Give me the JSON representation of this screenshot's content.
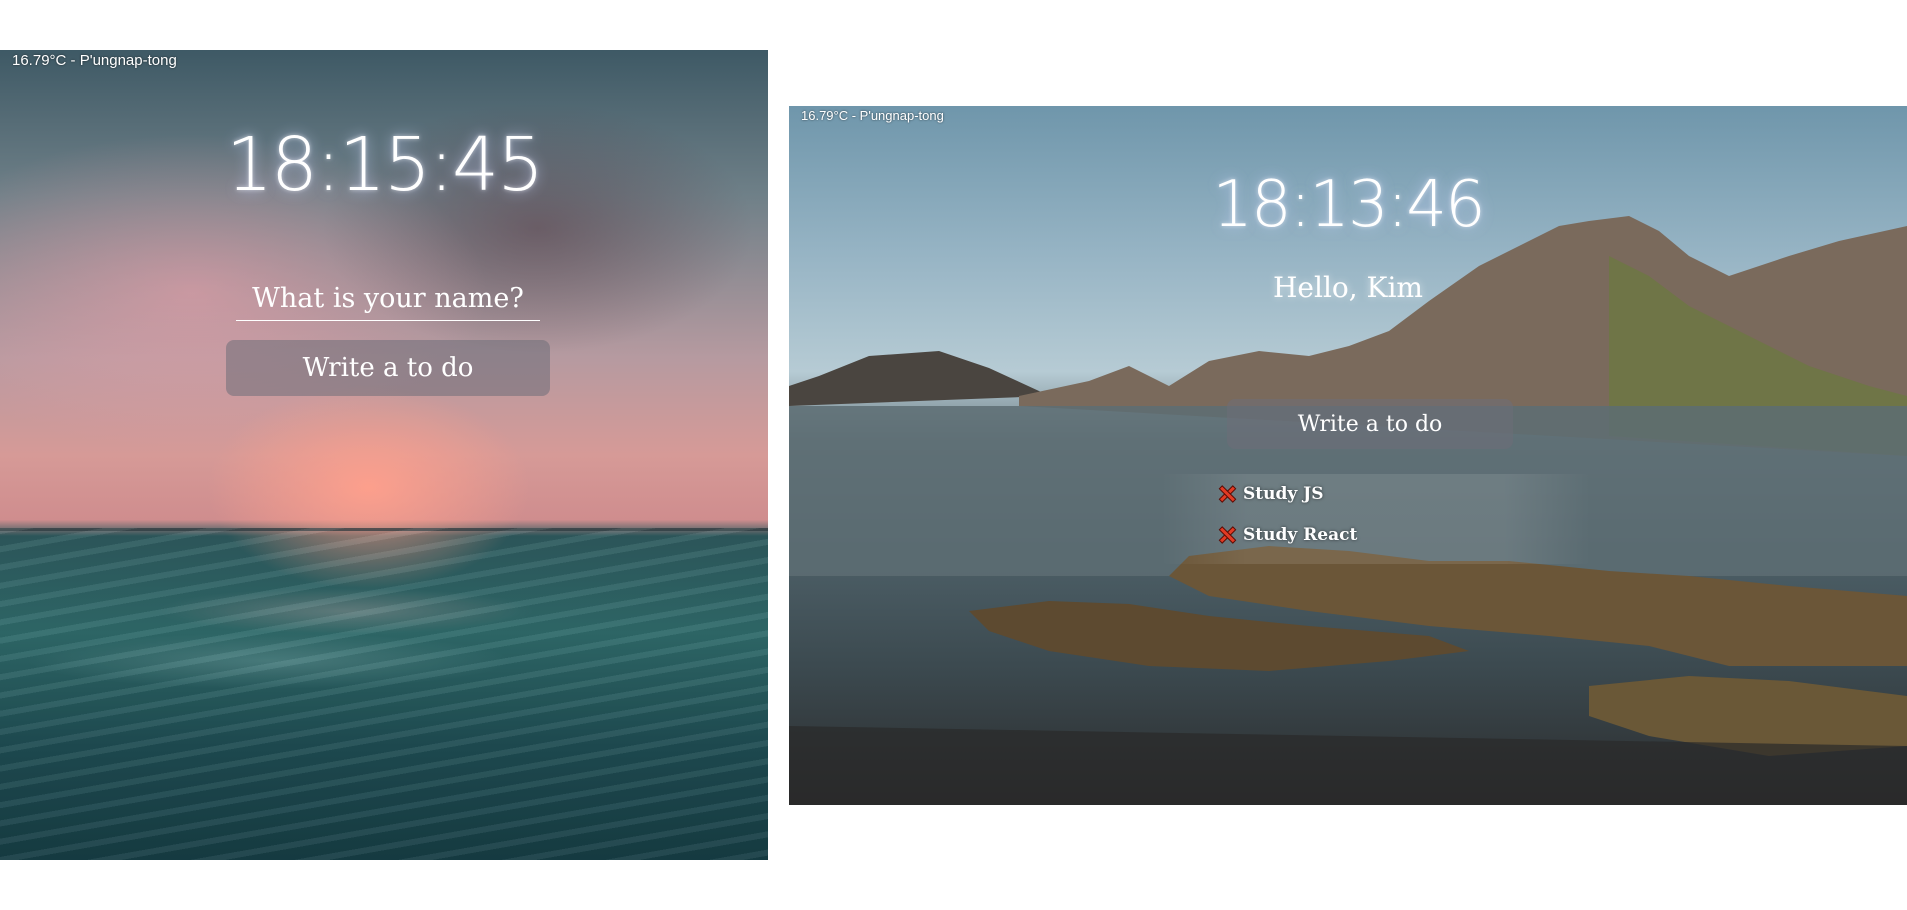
{
  "left_screen": {
    "weather": "16.79°C - P'ungnap-tong",
    "clock": "18:15:45",
    "name_input": {
      "placeholder": "What is your name?",
      "value": ""
    },
    "todo_input": {
      "placeholder": "Write a to do",
      "value": ""
    }
  },
  "right_screen": {
    "weather": "16.79°C - P'ungnap-tong",
    "clock": "18:13:46",
    "greeting": "Hello, Kim",
    "todo_input": {
      "placeholder": "Write a to do",
      "value": ""
    },
    "todos": [
      {
        "text": "Study JS",
        "delete_icon": "red-x-icon"
      },
      {
        "text": "Study React",
        "delete_icon": "red-x-icon"
      }
    ]
  },
  "colors": {
    "page_background": "#ffffff",
    "delete_icon": "#e23b24",
    "text": "#ffffff"
  }
}
